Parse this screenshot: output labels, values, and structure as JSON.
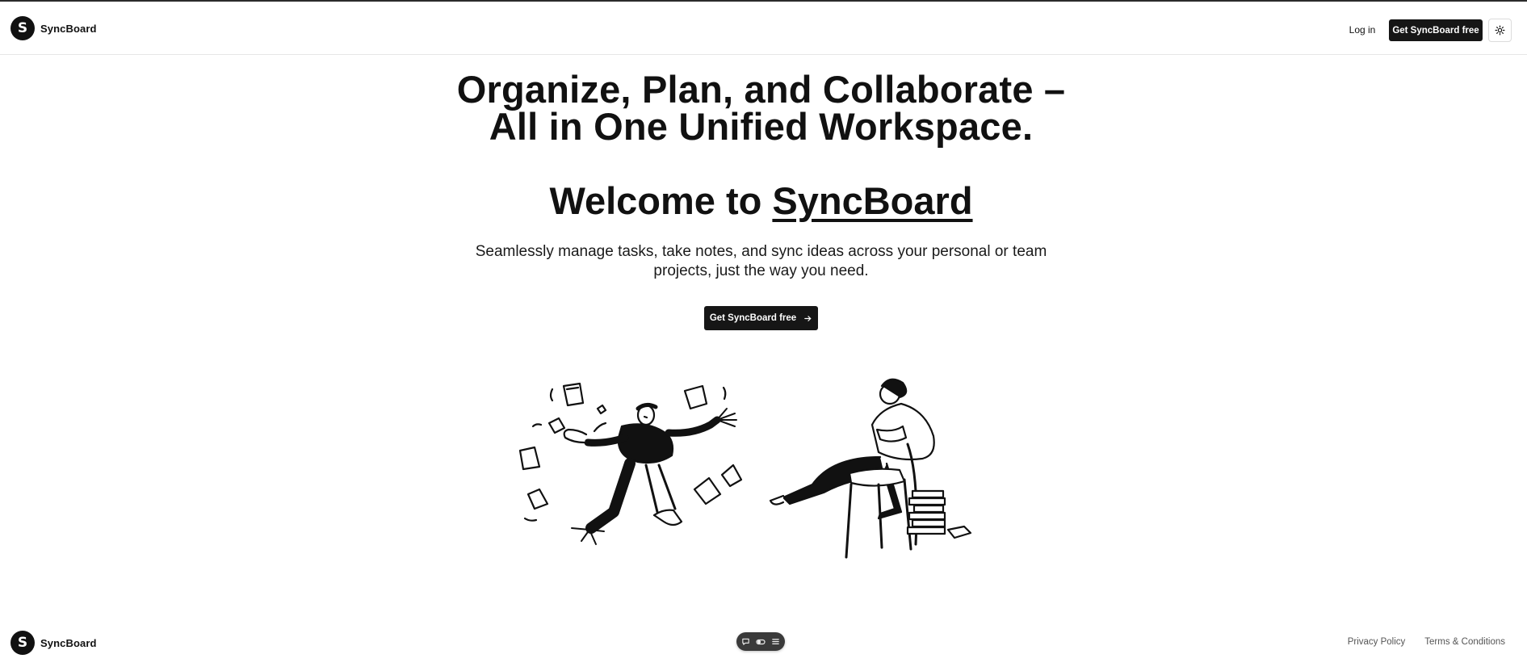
{
  "header": {
    "brand_letter": "S",
    "brand_name": "SyncBoard",
    "login_label": "Log in",
    "cta_label": "Get SyncBoard free",
    "theme_icon": "sun-icon"
  },
  "hero": {
    "headline_line1": "Organize, Plan, and Collaborate –",
    "headline_line2": "All in One Unified Workspace.",
    "welcome_prefix": "Welcome to ",
    "welcome_brand": "SyncBoard",
    "subtitle_line1": "Seamlessly manage tasks, take notes, and sync ideas across your personal or team",
    "subtitle_line2": "projects, just the way you need.",
    "cta_label": "Get SyncBoard free",
    "cta_icon": "arrow-right-icon"
  },
  "footer": {
    "brand_letter": "S",
    "brand_name": "SyncBoard",
    "toolbar_icons": [
      "chat-icon",
      "toggle-icon",
      "menu-icon"
    ],
    "links": [
      "Privacy Policy",
      "Terms & Conditions"
    ]
  },
  "colors": {
    "primary": "#161616",
    "background": "#ffffff",
    "muted_text": "#555555",
    "toolbar_bg": "#3a3a3a"
  }
}
